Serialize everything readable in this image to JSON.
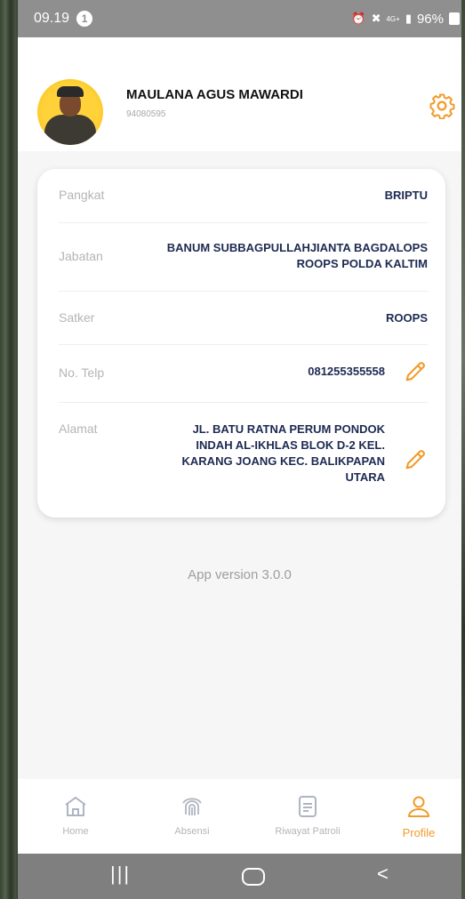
{
  "status": {
    "time": "09.19",
    "notif_count": "1",
    "signal_text": "4G+",
    "battery": "96%"
  },
  "profile": {
    "name": "MAULANA AGUS MAWARDI",
    "nrp": "94080595"
  },
  "details": [
    {
      "label": "Pangkat",
      "value": "BRIPTU"
    },
    {
      "label": "Jabatan",
      "value": "BANUM SUBBAGPULLAHJIANTA BAGDALOPS ROOPS POLDA KALTIM"
    },
    {
      "label": "Satker",
      "value": "ROOPS"
    },
    {
      "label": "No. Telp",
      "value": "081255355558"
    },
    {
      "label": "Alamat",
      "value": "JL. BATU RATNA PERUM PONDOK INDAH AL-IKHLAS BLOK D-2 KEL. KARANG JOANG KEC. BALIKPAPAN UTARA"
    }
  ],
  "app_version": "App version 3.0.0",
  "nav": [
    {
      "label": "Home",
      "icon": "home-icon"
    },
    {
      "label": "Absensi",
      "icon": "fingerprint-icon"
    },
    {
      "label": "Riwayat Patroli",
      "icon": "document-icon"
    },
    {
      "label": "Profile",
      "icon": "user-icon",
      "active": true
    }
  ],
  "colors": {
    "accent": "#f29b2b",
    "value_text": "#1d2a52",
    "label_text": "#b5b5b5"
  }
}
